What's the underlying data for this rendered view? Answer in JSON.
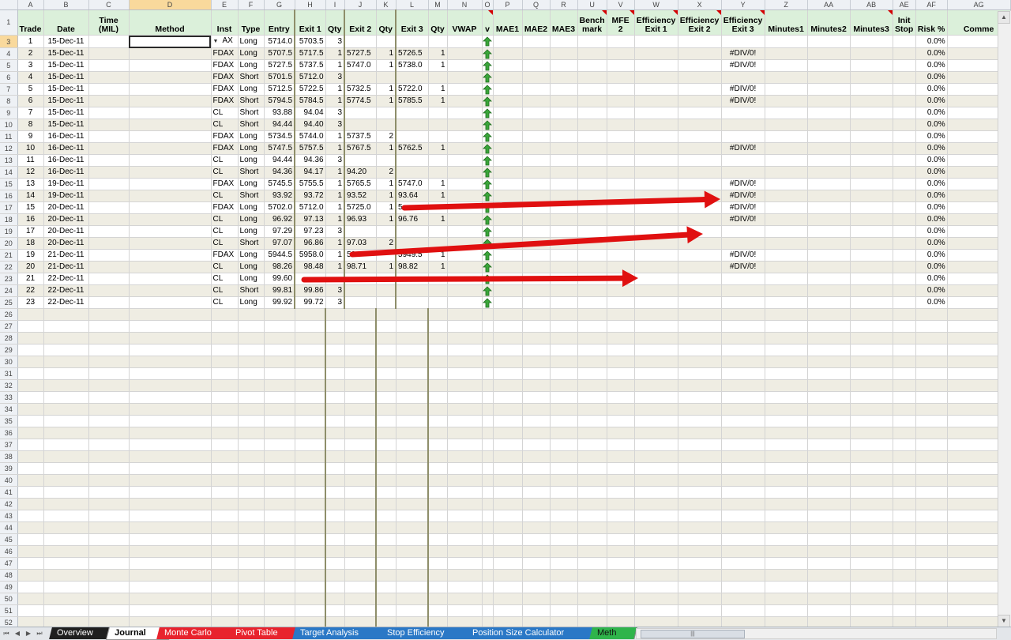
{
  "sheet": {
    "col_letters": [
      "A",
      "B",
      "C",
      "D",
      "E",
      "F",
      "G",
      "H",
      "I",
      "J",
      "K",
      "L",
      "M",
      "N",
      "O",
      "P",
      "Q",
      "R",
      "U",
      "V",
      "W",
      "X",
      "Y",
      "Z",
      "AA",
      "AB",
      "AE",
      "AF",
      "AG"
    ],
    "selected_column": "D",
    "headers": [
      "Trade",
      "Date",
      "Time (MIL)",
      "Method",
      "Inst",
      "Type",
      "Entry",
      "Exit 1",
      "Qty",
      "Exit 2",
      "Qty",
      "Exit 3",
      "Qty",
      "VWAP",
      "v",
      "MAE1",
      "MAE2",
      "MAE3",
      "Bench mark",
      "MFE 2",
      "Efficiency Exit 1",
      "Efficiency Exit 2",
      "Efficiency Exit 3",
      "Minutes1",
      "Minutes2",
      "Minutes3",
      "Init Stop",
      "Risk %",
      "Comme"
    ],
    "header_row_number": "1",
    "dropdown_glyph": "▼",
    "dropdown_partial_text": "AX",
    "trades": [
      {
        "row": "3",
        "trade": "1",
        "date": "15-Dec-11",
        "inst": "",
        "type": "Long",
        "entry": "5714.0",
        "exit1": "5703.5",
        "qty1": "3",
        "exit2": "",
        "qty2": "",
        "exit3": "",
        "qty3": "",
        "eff3": "",
        "risk": "0.0%"
      },
      {
        "row": "4",
        "trade": "2",
        "date": "15-Dec-11",
        "inst": "FDAX",
        "type": "Long",
        "entry": "5707.5",
        "exit1": "5717.5",
        "qty1": "1",
        "exit2": "5727.5",
        "qty2": "1",
        "exit3": "5726.5",
        "qty3": "1",
        "eff3": "#DIV/0!",
        "risk": "0.0%"
      },
      {
        "row": "5",
        "trade": "3",
        "date": "15-Dec-11",
        "inst": "FDAX",
        "type": "Long",
        "entry": "5727.5",
        "exit1": "5737.5",
        "qty1": "1",
        "exit2": "5747.0",
        "qty2": "1",
        "exit3": "5738.0",
        "qty3": "1",
        "eff3": "#DIV/0!",
        "risk": "0.0%"
      },
      {
        "row": "6",
        "trade": "4",
        "date": "15-Dec-11",
        "inst": "FDAX",
        "type": "Short",
        "entry": "5701.5",
        "exit1": "5712.0",
        "qty1": "3",
        "exit2": "",
        "qty2": "",
        "exit3": "",
        "qty3": "",
        "eff3": "",
        "risk": "0.0%"
      },
      {
        "row": "7",
        "trade": "5",
        "date": "15-Dec-11",
        "inst": "FDAX",
        "type": "Long",
        "entry": "5712.5",
        "exit1": "5722.5",
        "qty1": "1",
        "exit2": "5732.5",
        "qty2": "1",
        "exit3": "5722.0",
        "qty3": "1",
        "eff3": "#DIV/0!",
        "risk": "0.0%"
      },
      {
        "row": "8",
        "trade": "6",
        "date": "15-Dec-11",
        "inst": "FDAX",
        "type": "Short",
        "entry": "5794.5",
        "exit1": "5784.5",
        "qty1": "1",
        "exit2": "5774.5",
        "qty2": "1",
        "exit3": "5785.5",
        "qty3": "1",
        "eff3": "#DIV/0!",
        "risk": "0.0%"
      },
      {
        "row": "9",
        "trade": "7",
        "date": "15-Dec-11",
        "inst": "CL",
        "type": "Short",
        "entry": "93.88",
        "exit1": "94.04",
        "qty1": "3",
        "exit2": "",
        "qty2": "",
        "exit3": "",
        "qty3": "",
        "eff3": "",
        "risk": "0.0%"
      },
      {
        "row": "10",
        "trade": "8",
        "date": "15-Dec-11",
        "inst": "CL",
        "type": "Short",
        "entry": "94.44",
        "exit1": "94.40",
        "qty1": "3",
        "exit2": "",
        "qty2": "",
        "exit3": "",
        "qty3": "",
        "eff3": "",
        "risk": "0.0%"
      },
      {
        "row": "11",
        "trade": "9",
        "date": "16-Dec-11",
        "inst": "FDAX",
        "type": "Long",
        "entry": "5734.5",
        "exit1": "5744.0",
        "qty1": "1",
        "exit2": "5737.5",
        "qty2": "2",
        "exit3": "",
        "qty3": "",
        "eff3": "",
        "risk": "0.0%"
      },
      {
        "row": "12",
        "trade": "10",
        "date": "16-Dec-11",
        "inst": "FDAX",
        "type": "Long",
        "entry": "5747.5",
        "exit1": "5757.5",
        "qty1": "1",
        "exit2": "5767.5",
        "qty2": "1",
        "exit3": "5762.5",
        "qty3": "1",
        "eff3": "#DIV/0!",
        "risk": "0.0%"
      },
      {
        "row": "13",
        "trade": "11",
        "date": "16-Dec-11",
        "inst": "CL",
        "type": "Long",
        "entry": "94.44",
        "exit1": "94.36",
        "qty1": "3",
        "exit2": "",
        "qty2": "",
        "exit3": "",
        "qty3": "",
        "eff3": "",
        "risk": "0.0%"
      },
      {
        "row": "14",
        "trade": "12",
        "date": "16-Dec-11",
        "inst": "CL",
        "type": "Short",
        "entry": "94.36",
        "exit1": "94.17",
        "qty1": "1",
        "exit2": "94.20",
        "qty2": "2",
        "exit3": "",
        "qty3": "",
        "eff3": "",
        "risk": "0.0%"
      },
      {
        "row": "15",
        "trade": "13",
        "date": "19-Dec-11",
        "inst": "FDAX",
        "type": "Long",
        "entry": "5745.5",
        "exit1": "5755.5",
        "qty1": "1",
        "exit2": "5765.5",
        "qty2": "1",
        "exit3": "5747.0",
        "qty3": "1",
        "eff3": "#DIV/0!",
        "risk": "0.0%"
      },
      {
        "row": "16",
        "trade": "14",
        "date": "19-Dec-11",
        "inst": "CL",
        "type": "Short",
        "entry": "93.92",
        "exit1": "93.72",
        "qty1": "1",
        "exit2": "93.52",
        "qty2": "1",
        "exit3": "93.64",
        "qty3": "1",
        "eff3": "#DIV/0!",
        "risk": "0.0%"
      },
      {
        "row": "17",
        "trade": "15",
        "date": "20-Dec-11",
        "inst": "FDAX",
        "type": "Long",
        "entry": "5702.0",
        "exit1": "5712.0",
        "qty1": "1",
        "exit2": "5725.0",
        "qty2": "1",
        "exit3": "5",
        "qty3": "",
        "eff3": "#DIV/0!",
        "risk": "0.0%"
      },
      {
        "row": "18",
        "trade": "16",
        "date": "20-Dec-11",
        "inst": "CL",
        "type": "Long",
        "entry": "96.92",
        "exit1": "97.13",
        "qty1": "1",
        "exit2": "96.93",
        "qty2": "1",
        "exit3": "96.76",
        "qty3": "1",
        "eff3": "#DIV/0!",
        "risk": "0.0%"
      },
      {
        "row": "19",
        "trade": "17",
        "date": "20-Dec-11",
        "inst": "CL",
        "type": "Long",
        "entry": "97.29",
        "exit1": "97.23",
        "qty1": "3",
        "exit2": "",
        "qty2": "",
        "exit3": "",
        "qty3": "",
        "eff3": "",
        "risk": "0.0%"
      },
      {
        "row": "20",
        "trade": "18",
        "date": "20-Dec-11",
        "inst": "CL",
        "type": "Short",
        "entry": "97.07",
        "exit1": "96.86",
        "qty1": "1",
        "exit2": "97.03",
        "qty2": "2",
        "exit3": "",
        "qty3": "",
        "eff3": "",
        "risk": "0.0%"
      },
      {
        "row": "21",
        "trade": "19",
        "date": "21-Dec-11",
        "inst": "FDAX",
        "type": "Long",
        "entry": "5944.5",
        "exit1": "5958.0",
        "qty1": "1",
        "exit2": "59",
        "qty2": "",
        "exit3": "5949.5",
        "qty3": "1",
        "eff3": "#DIV/0!",
        "risk": "0.0%"
      },
      {
        "row": "22",
        "trade": "20",
        "date": "21-Dec-11",
        "inst": "CL",
        "type": "Long",
        "entry": "98.26",
        "exit1": "98.48",
        "qty1": "1",
        "exit2": "98.71",
        "qty2": "1",
        "exit3": "98.82",
        "qty3": "1",
        "eff3": "#DIV/0!",
        "risk": "0.0%"
      },
      {
        "row": "23",
        "trade": "21",
        "date": "22-Dec-11",
        "inst": "CL",
        "type": "Long",
        "entry": "99.60",
        "exit1": "",
        "qty1": "",
        "exit2": "",
        "qty2": "",
        "exit3": "",
        "qty3": "",
        "eff3": "",
        "risk": "0.0%"
      },
      {
        "row": "24",
        "trade": "22",
        "date": "22-Dec-11",
        "inst": "CL",
        "type": "Short",
        "entry": "99.81",
        "exit1": "99.86",
        "qty1": "3",
        "exit2": "",
        "qty2": "",
        "exit3": "",
        "qty3": "",
        "eff3": "",
        "risk": "0.0%"
      },
      {
        "row": "25",
        "trade": "23",
        "date": "22-Dec-11",
        "inst": "CL",
        "type": "Long",
        "entry": "99.92",
        "exit1": "99.72",
        "qty1": "3",
        "exit2": "",
        "qty2": "",
        "exit3": "",
        "qty3": "",
        "eff3": "",
        "risk": "0.0%"
      }
    ],
    "empty_rows": [
      "26",
      "27",
      "28",
      "29",
      "30",
      "31",
      "32",
      "33",
      "34",
      "35",
      "36",
      "37",
      "38",
      "39",
      "40",
      "41",
      "42",
      "43",
      "44",
      "45",
      "46",
      "47",
      "48",
      "49",
      "50",
      "51",
      "52"
    ],
    "colors": {
      "header_fill": "#dbf0da",
      "band_fill": "#efede3",
      "arrow_icon": "#3aa63a",
      "annotation_arrow": "#e01010",
      "comment_marker": "#d40000"
    },
    "annotation_arrow_count": 3
  },
  "tabs": [
    {
      "label": "Overview",
      "color": "#1f1f1f"
    },
    {
      "label": "Journal",
      "color": "#ffffff",
      "active": true
    },
    {
      "label": "Monte Carlo",
      "color": "#e8232d"
    },
    {
      "label": "Pivot Table",
      "color": "#e8232d"
    },
    {
      "label": "Target Analysis",
      "color": "#2a78c6"
    },
    {
      "label": "Stop Efficiency",
      "color": "#2a78c6"
    },
    {
      "label": "Position Size Calculator",
      "color": "#2a78c6"
    },
    {
      "label": "Meth",
      "color": "#2fb44b"
    }
  ],
  "scrollbar": {
    "thumb_glyph": "|||"
  }
}
